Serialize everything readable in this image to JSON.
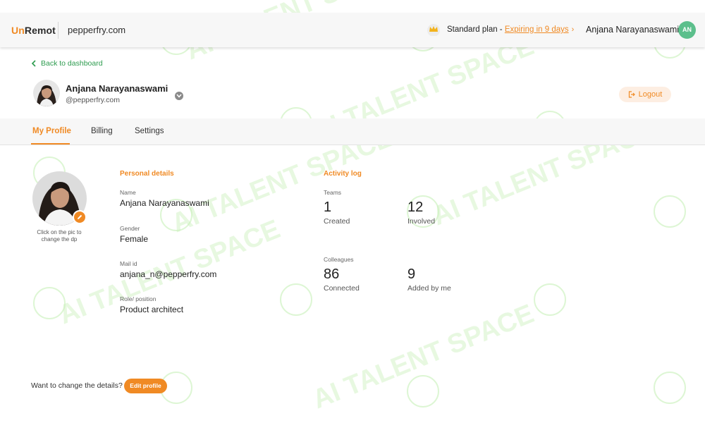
{
  "header": {
    "brand_part1": "Un",
    "brand_part2": "Remot",
    "company": "pepperfry.com",
    "crown_icon": "crown-icon",
    "plan_label": "Standard plan - ",
    "plan_expiry": "Expiring in 9 days",
    "user_name": "Anjana Narayanaswami",
    "user_initials": "AN"
  },
  "back_link": "Back to dashboard",
  "profile": {
    "name": "Anjana Narayanaswami",
    "handle": "@pepperfry.com",
    "logout_label": "Logout"
  },
  "tabs": [
    {
      "label": "My Profile",
      "active": true
    },
    {
      "label": "Billing",
      "active": false
    },
    {
      "label": "Settings",
      "active": false
    }
  ],
  "photo_hint": "Click on the pic to change the dp",
  "personal": {
    "title": "Personal details",
    "fields": [
      {
        "label": "Name",
        "value": "Anjana Narayanaswami"
      },
      {
        "label": "Gender",
        "value": "Female"
      },
      {
        "label": "Mail id",
        "value": "anjana_n@pepperfry.com"
      },
      {
        "label": "Role/ position",
        "value": "Product architect"
      }
    ]
  },
  "activity": {
    "title": "Activity log",
    "teams_label": "Teams",
    "teams": [
      {
        "value": "1",
        "label": "Created"
      },
      {
        "value": "12",
        "label": "Involved"
      }
    ],
    "colleagues_label": "Colleagues",
    "colleagues": [
      {
        "value": "86",
        "label": "Connected"
      },
      {
        "value": "9",
        "label": "Added by me"
      }
    ]
  },
  "footer": {
    "prompt": "Want to change the details?",
    "edit_label": "Edit profile"
  },
  "watermark": "AI TALENT SPACE",
  "colors": {
    "accent": "#f08a24",
    "link_green": "#2c9b4e",
    "avatar_green": "#5cbf8c",
    "watermark_green": "#9be08a"
  }
}
